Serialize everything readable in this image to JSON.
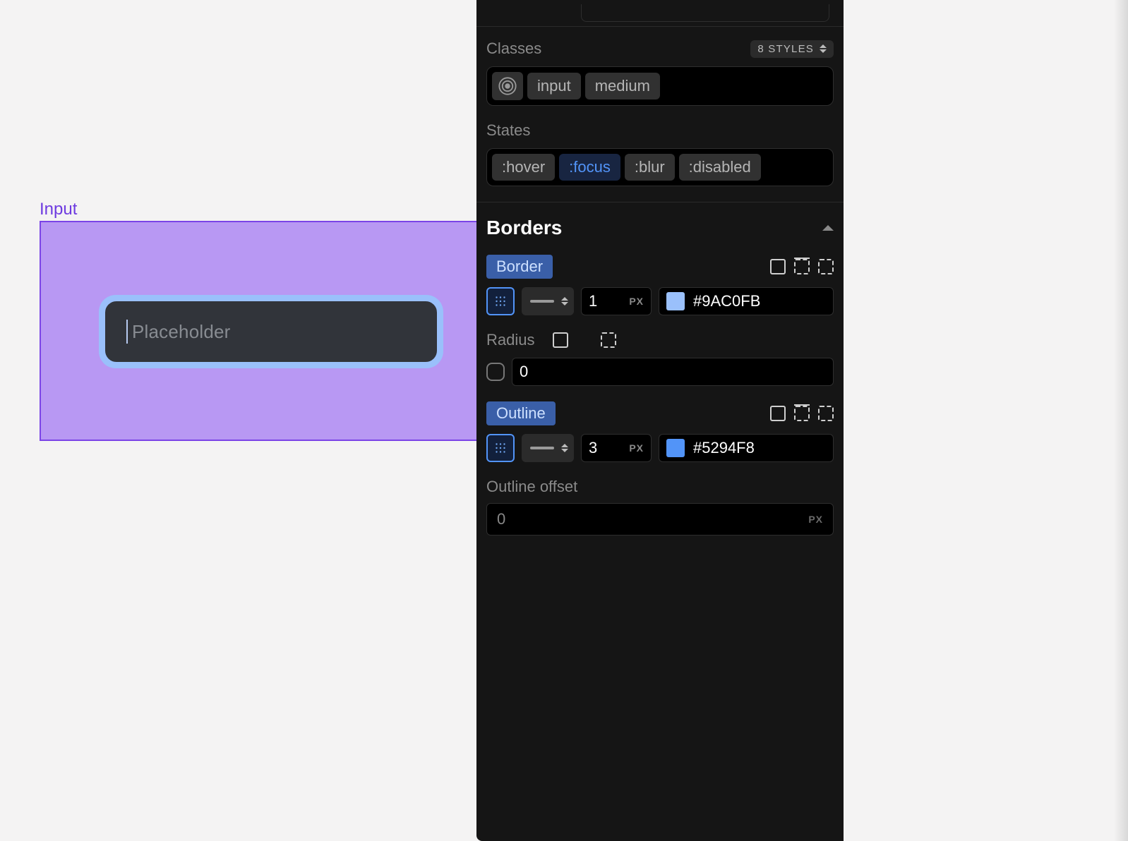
{
  "canvas": {
    "selection_label": "Input",
    "input_placeholder": "Placeholder"
  },
  "panel": {
    "classes": {
      "label": "Classes",
      "styles_count_label": "8 STYLES",
      "tags": [
        "input",
        "medium"
      ]
    },
    "states": {
      "label": "States",
      "items": [
        {
          "label": ":hover",
          "active": false
        },
        {
          "label": ":focus",
          "active": true
        },
        {
          "label": ":blur",
          "active": false
        },
        {
          "label": ":disabled",
          "active": false
        }
      ]
    },
    "borders": {
      "title": "Borders",
      "border": {
        "label": "Border",
        "width": "1",
        "unit": "PX",
        "color_hex": "#9AC0FB"
      },
      "radius": {
        "label": "Radius",
        "value": "0"
      },
      "outline": {
        "label": "Outline",
        "width": "3",
        "unit": "PX",
        "color_hex": "#5294F8"
      },
      "outline_offset": {
        "label": "Outline offset",
        "value": "0",
        "unit": "PX"
      }
    }
  }
}
